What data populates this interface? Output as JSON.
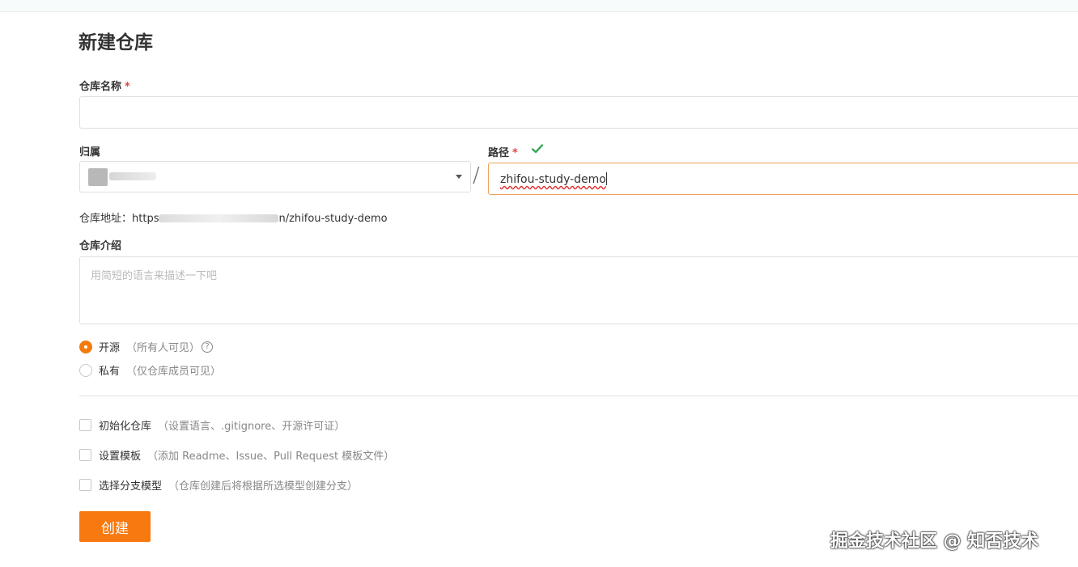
{
  "page": {
    "title": "新建仓库"
  },
  "form": {
    "name_label": "仓库名称",
    "required_mark": "*",
    "owner_label": "归属",
    "path_label": "路径",
    "path_value": "zhifou-study-demo",
    "separator": "/",
    "repo_url_prefix": "仓库地址：",
    "repo_url_start": "https",
    "repo_url_end": "n/zhifou-study-demo",
    "desc_label": "仓库介绍",
    "desc_placeholder": "用简短的语言来描述一下吧"
  },
  "visibility": {
    "options": [
      {
        "label": "开源",
        "hint": "（所有人可见）",
        "checked": true,
        "help": "?"
      },
      {
        "label": "私有",
        "hint": "（仅仓库成员可见）",
        "checked": false
      }
    ]
  },
  "options": [
    {
      "label": "初始化仓库",
      "hint": "（设置语言、.gitignore、开源许可证）"
    },
    {
      "label": "设置模板",
      "hint": "（添加 Readme、Issue、Pull Request 模板文件）"
    },
    {
      "label": "选择分支模型",
      "hint": "（仓库创建后将根据所选模型创建分支）"
    }
  ],
  "actions": {
    "create_label": "创建"
  },
  "watermark": "掘金技术社区 @ 知否技术",
  "colors": {
    "accent": "#f7790f",
    "required": "#e1463f",
    "valid": "#3aa757"
  }
}
